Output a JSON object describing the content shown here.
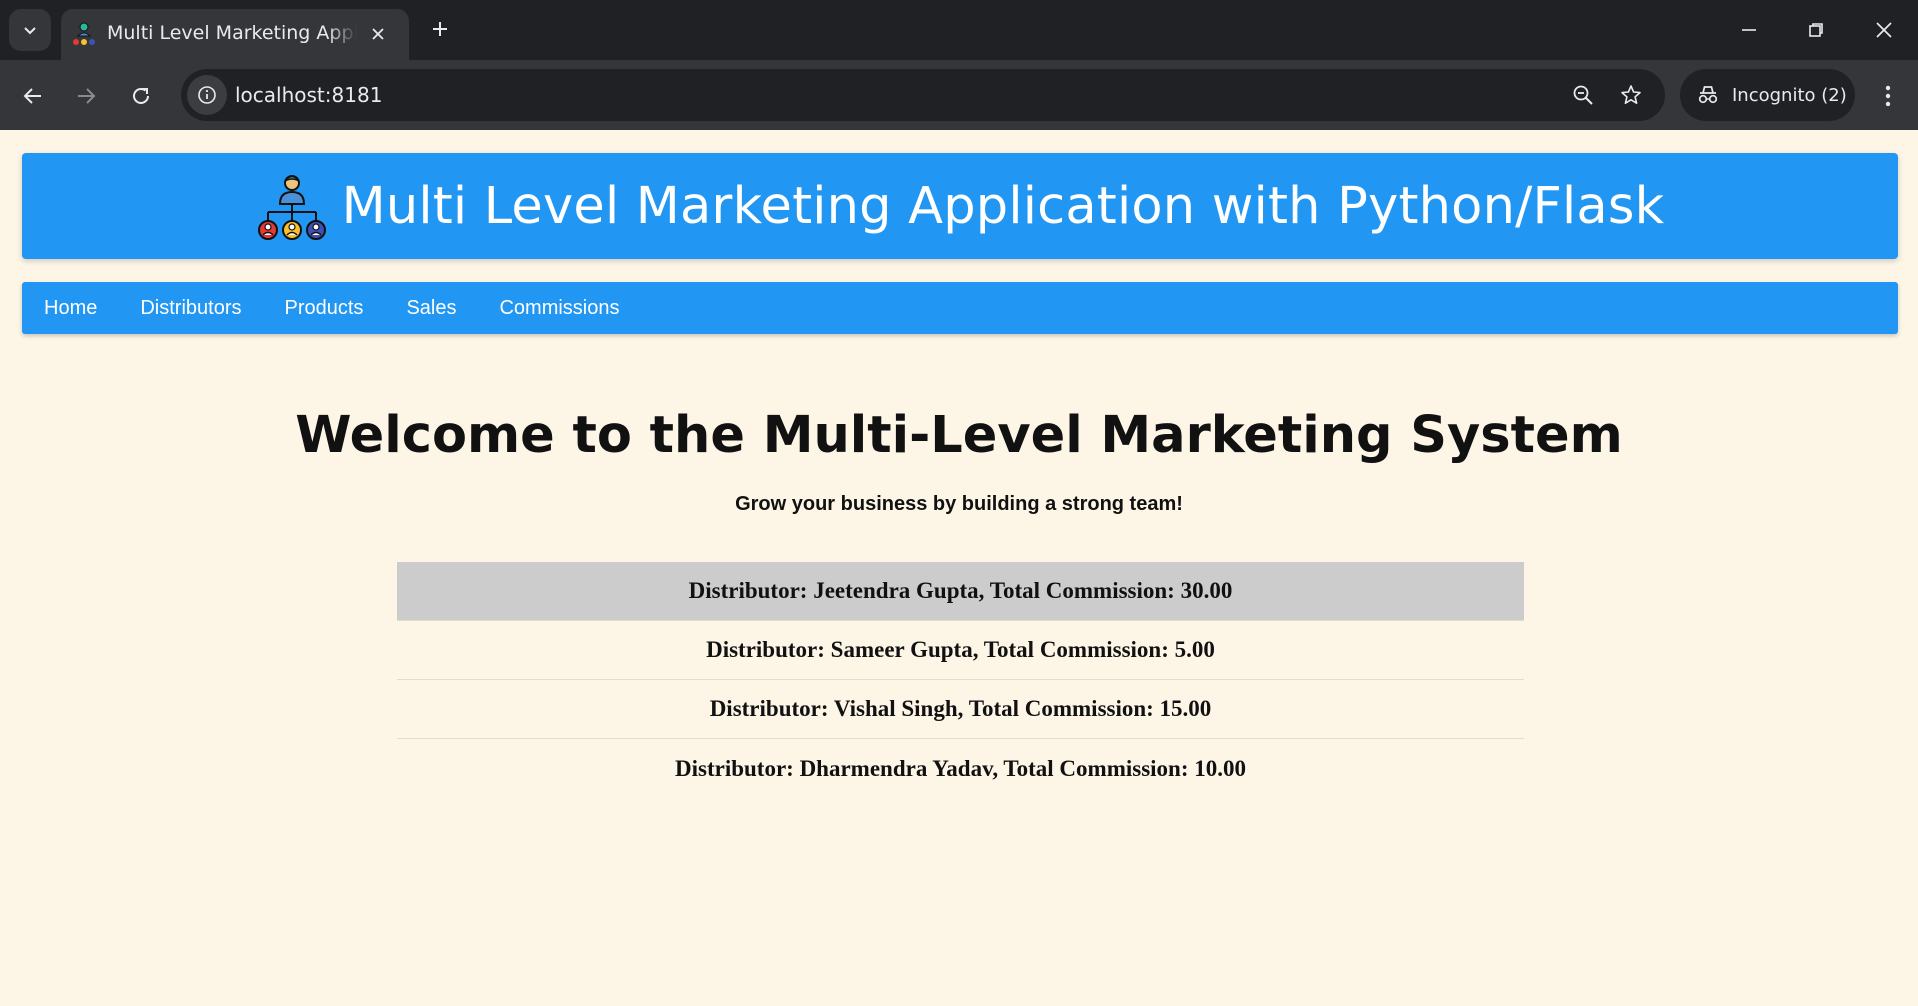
{
  "browser": {
    "tab_title": "Multi Level Marketing Application with Python/Flask",
    "url": "localhost:8181",
    "incognito_label": "Incognito (2)"
  },
  "header": {
    "title": "Multi Level Marketing Application with Python/Flask",
    "logo_icon": "team-hierarchy-icon"
  },
  "nav": {
    "items": [
      {
        "label": "Home"
      },
      {
        "label": "Distributors"
      },
      {
        "label": "Products"
      },
      {
        "label": "Sales"
      },
      {
        "label": "Commissions"
      }
    ]
  },
  "main": {
    "heading": "Welcome to the Multi-Level Marketing System",
    "tagline": "Grow your business by building a strong team!",
    "commissions": [
      {
        "text": "Distributor: Jeetendra Gupta, Total Commission: 30.00",
        "highlighted": true
      },
      {
        "text": "Distributor: Sameer Gupta, Total Commission: 5.00",
        "highlighted": false
      },
      {
        "text": "Distributor: Vishal Singh, Total Commission: 15.00",
        "highlighted": false
      },
      {
        "text": "Distributor: Dharmendra Yadav, Total Commission: 10.00",
        "highlighted": false
      }
    ]
  },
  "colors": {
    "accent": "#2196f3",
    "page_background": "#fdf5e6",
    "highlight_row": "#cccccc"
  }
}
